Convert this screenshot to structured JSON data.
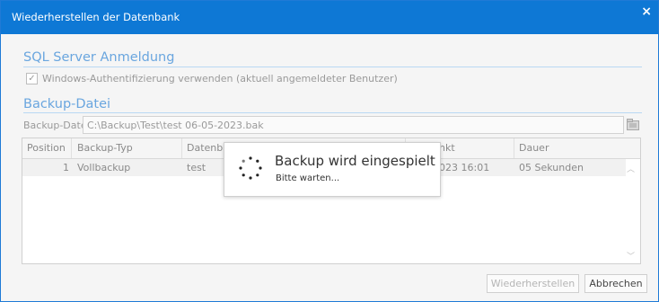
{
  "window": {
    "title": "Wiederherstellen der Datenbank",
    "close_glyph": "×"
  },
  "sql_section": {
    "title": "SQL Server Anmeldung",
    "checkbox_label": "Windows-Authentifizierung verwenden (aktuell angemeldeter Benutzer)",
    "checked": true,
    "check_glyph": "✓"
  },
  "backup_section": {
    "title": "Backup-Datei",
    "file_label": "Backup-Datei",
    "file_value": "C:\\Backup\\Test\\test 06-05-2023.bak"
  },
  "table": {
    "columns": [
      "Position",
      "Backup-Typ",
      "Datenba",
      "nkt",
      "Dauer"
    ],
    "rows": [
      {
        "position": "1",
        "type": "Vollbackup",
        "database": "test",
        "timepoint": "023 16:01",
        "duration": "05 Sekunden"
      }
    ]
  },
  "buttons": {
    "restore": "Wiederherstellen",
    "cancel": "Abbrechen"
  },
  "overlay": {
    "title": "Backup wird eingespielt",
    "subtitle": "Bitte warten..."
  },
  "colors": {
    "accent": "#0e78d5",
    "section_title": "#6aa6df"
  }
}
